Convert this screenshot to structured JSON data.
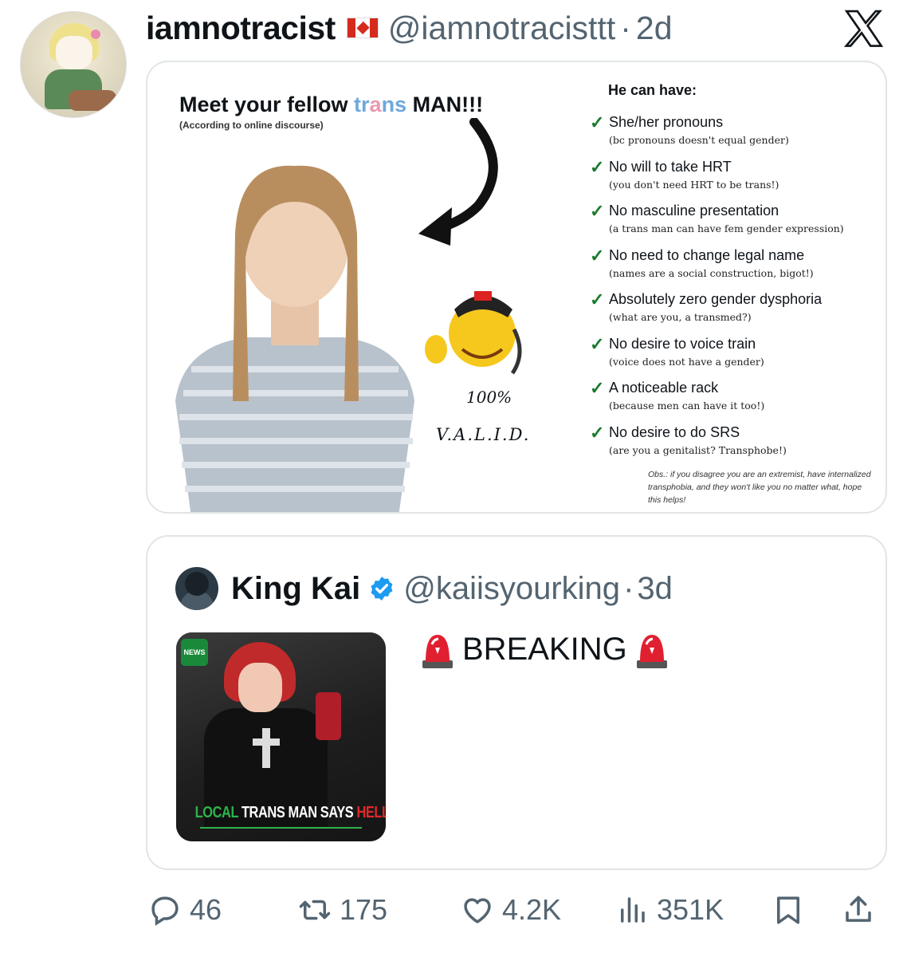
{
  "post": {
    "author_name": "iamnotracist",
    "author_flag": "canada-flag",
    "handle": "@iamnotracisttt",
    "separator": "·",
    "time": "2d"
  },
  "meme": {
    "title_part1": "Meet your fellow ",
    "title_trans_t": "tr",
    "title_trans_a": "a",
    "title_trans_n": "ns",
    "title_part2": " MAN!!!",
    "subtitle": "(According to online discourse)",
    "valid_pct": "100%",
    "valid_word": "V.A.L.I.D.",
    "list_heading": "He can have:",
    "items": [
      {
        "main": "She/her pronouns",
        "note": "(bc pronouns doesn't equal gender)"
      },
      {
        "main": "No will to take HRT",
        "note": "(you don't need HRT to be trans!)"
      },
      {
        "main": "No masculine presentation",
        "note": "(a trans man can have fem gender expression)"
      },
      {
        "main": "No need to change legal name",
        "note": "(names are a social construction, bigot!)"
      },
      {
        "main": "Absolutely zero gender dysphoria",
        "note": "(what are you, a transmed?)"
      },
      {
        "main": "No desire to voice train",
        "note": "(voice does not have a gender)"
      },
      {
        "main": "A noticeable rack",
        "note": "(because men can have it too!)"
      },
      {
        "main": "No desire to do SRS",
        "note": "(are you a genitalist? Transphobe!)"
      }
    ],
    "obs": "Obs.: if you disagree you are an extremist, have internalized transphobia, and they won't like you no matter what, hope this helps!"
  },
  "quote": {
    "author_name": "King Kai",
    "handle": "@kaiisyourking",
    "separator": "·",
    "time": "3d",
    "text": "BREAKING",
    "thumb_caption_1": "LOCAL",
    "thumb_caption_2": " TRANS MAN SAYS ",
    "thumb_caption_3": "HELLO",
    "thumb_badge": "NEWS"
  },
  "actions": {
    "replies": "46",
    "reposts": "175",
    "likes": "4.2K",
    "views": "351K"
  },
  "colors": {
    "text": "#0f1419",
    "muted": "#536471",
    "border": "#e1e5e8",
    "verified": "#1d9bf0",
    "check": "#1a7a2c"
  }
}
